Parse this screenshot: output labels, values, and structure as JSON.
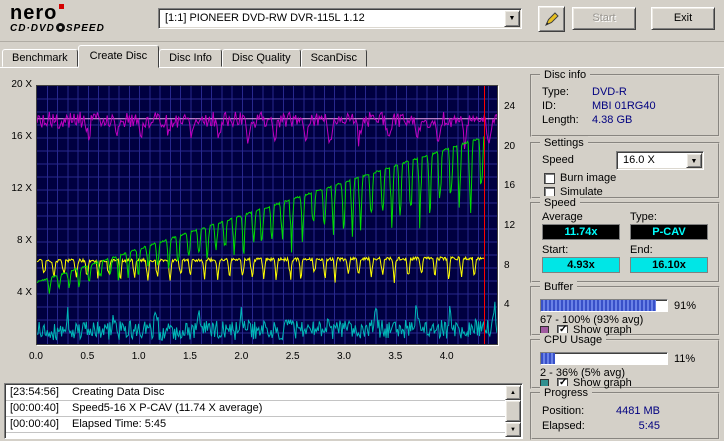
{
  "header": {
    "logo_brand": "nero",
    "logo_product_left": "CD·DVD",
    "logo_product_right": "SPEED",
    "drive_selector": "[1:1]   PIONEER DVD-RW  DVR-115L 1.12",
    "start_label": "Start",
    "exit_label": "Exit"
  },
  "icons": {
    "dropdown": "▼",
    "scroll_up": "▲",
    "scroll_down": "▼"
  },
  "tabs": {
    "items": [
      "Benchmark",
      "Create Disc",
      "Disc Info",
      "Disc Quality",
      "ScanDisc"
    ],
    "active": "Create Disc"
  },
  "chart_data": {
    "type": "line",
    "x_axis": {
      "unit": "GB",
      "range": [
        0,
        4.5
      ],
      "tick_values": [
        0,
        0.5,
        1,
        1.5,
        2,
        2.5,
        3,
        3.5,
        4
      ],
      "tick_labels": [
        "0.0",
        "0.5",
        "1.0",
        "1.5",
        "2.0",
        "2.5",
        "3.0",
        "3.5",
        "4.0"
      ]
    },
    "left_axis": {
      "range": [
        0,
        20
      ],
      "tick_values": [
        20,
        16,
        12,
        8,
        4
      ],
      "tick_labels": [
        "20 X",
        "16 X",
        "12 X",
        "8 X",
        "4 X"
      ]
    },
    "right_axis": {
      "range": [
        0,
        26.2
      ],
      "tick_values": [
        24,
        20,
        16,
        12,
        8,
        4
      ],
      "tick_labels": [
        "24",
        "20",
        "16",
        "12",
        "8",
        "4"
      ]
    },
    "background": "#000040",
    "grid_color": "#28288e",
    "end_marker": {
      "x": 4.36,
      "color": "#ff0000"
    },
    "series": [
      {
        "name": "buffer-average",
        "color": "#f0a0f0",
        "axis": "right",
        "gen": {
          "type": "flat",
          "value": 22.9,
          "x_end": 4.5
        }
      },
      {
        "name": "cpu-usage",
        "color": "#00b8b8",
        "axis": "left",
        "summary": {
          "min_pct": 2,
          "max_pct": 36,
          "avg_pct": 5
        },
        "gen": {
          "start": 1.15,
          "end": 1.3,
          "x_end": 4.5,
          "step": 0.01,
          "noise": 1.5,
          "spike_start": 0.3,
          "spike_gap": 0.4,
          "spike_width": 0.03,
          "spike_depth_start": -1.1,
          "spike_depth_end": -1.5,
          "min": 0.15,
          "max": 3.4,
          "seed": 41
        }
      },
      {
        "name": "secondary-speed",
        "color": "#ffff00",
        "axis": "left",
        "summary": {
          "level_x": 6.6
        },
        "gen": {
          "start": 6.55,
          "end": 6.75,
          "x_end": 4.36,
          "step": 0.008,
          "noise": 0.25,
          "spike_start": 0.07,
          "spike_gap": 0.115,
          "spike_width": 0.02,
          "spike_depth_start": 1.25,
          "spike_depth_end": 1.6,
          "min": 4.6,
          "seed": 23
        }
      },
      {
        "name": "buffer-level",
        "color": "#c000c0",
        "axis": "right",
        "summary": {
          "min_pct": 67,
          "max_pct": 100,
          "avg_pct": 93
        },
        "gen": {
          "start": 22.8,
          "end": 22.8,
          "x_end": 4.5,
          "step": 0.012,
          "noise": 1.6,
          "spike_start": 0.22,
          "spike_gap": 0.26,
          "spike_width": 0.035,
          "spike_depth_start": 1.4,
          "spike_depth_end": 2.4,
          "min": 19.6,
          "max": 23.85,
          "seed": 5
        }
      },
      {
        "name": "write-speed",
        "color": "#00dc00",
        "axis": "left",
        "summary": {
          "start_x": 4.93,
          "end_x": 16.1,
          "average_x": 11.74,
          "mode": "P-CAV"
        },
        "gen": {
          "start": 4.93,
          "end": 16.1,
          "x_end": 4.36,
          "step": 0.008,
          "noise": 0.12,
          "spike_start": 0.12,
          "spike_gap": 0.095,
          "spike_width": 0.022,
          "spike_depth_start": 0.9,
          "spike_depth_end": 5.2,
          "min": 0.4,
          "seed": 11
        }
      }
    ]
  },
  "disc_info": {
    "title": "Disc info",
    "type_label": "Type:",
    "type_value": "DVD-R",
    "id_label": "ID:",
    "id_value": "MBI 01RG40",
    "length_label": "Length:",
    "length_value": "4.38 GB"
  },
  "settings": {
    "title": "Settings",
    "speed_label": "Speed",
    "speed_value": "16.0 X",
    "checkboxes": [
      {
        "label": "Burn image",
        "checked": false
      },
      {
        "label": "Simulate",
        "checked": false
      }
    ]
  },
  "speed": {
    "title": "Speed",
    "average_label": "Average",
    "average_value": "11.74x",
    "type_label": "Type:",
    "type_value": "P-CAV",
    "start_label": "Start:",
    "start_value": "4.93x",
    "end_label": "End:",
    "end_value": "16.10x"
  },
  "buffer": {
    "title": "Buffer",
    "percent": 91,
    "percent_text": "91%",
    "range_text": "67 - 100% (93% avg)",
    "swatch_color": "#a05aa0",
    "show_graph_label": "Show graph",
    "show_graph_checked": true
  },
  "cpu": {
    "title": "CPU Usage",
    "percent": 11,
    "percent_text": "11%",
    "range_text": "2 - 36% (5% avg)",
    "swatch_color": "#2f8f8f",
    "show_graph_label": "Show graph",
    "show_graph_checked": true
  },
  "progress": {
    "title": "Progress",
    "position_label": "Position:",
    "position_value": "4481 MB",
    "elapsed_label": "Elapsed:",
    "elapsed_value": "5:45"
  },
  "log": {
    "entries": [
      {
        "time": "[23:54:56]",
        "text": "Creating Data Disc"
      },
      {
        "time": "[00:00:40]",
        "text": "Speed5-16 X P-CAV (11.74 X average)"
      },
      {
        "time": "[00:00:40]",
        "text": "Elapsed Time: 5:45"
      }
    ]
  }
}
